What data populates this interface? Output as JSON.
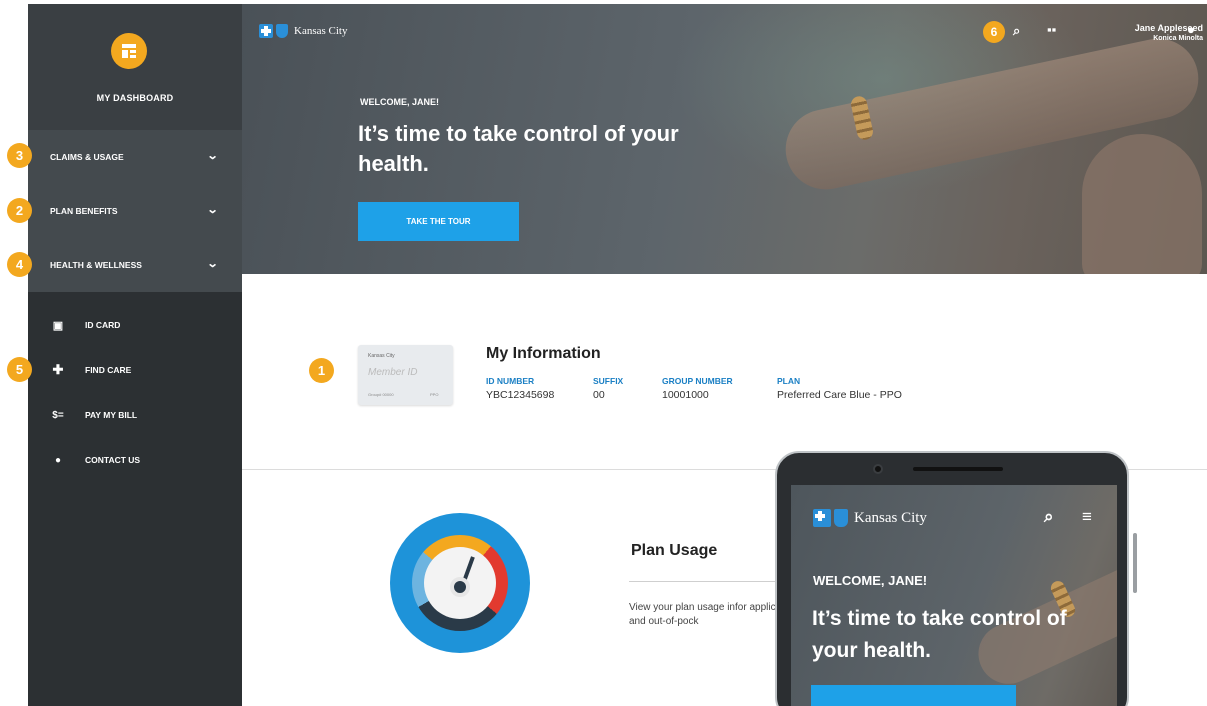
{
  "sidebar": {
    "dashboard_label": "MY DASHBOARD",
    "menu": [
      {
        "label": "CLAIMS & USAGE",
        "badge": "3"
      },
      {
        "label": "PLAN BENEFITS",
        "badge": "2"
      },
      {
        "label": "HEALTH & WELLNESS",
        "badge": "4"
      }
    ],
    "links": [
      {
        "label": "ID CARD",
        "icon": "id-card-icon",
        "glyph": "▣"
      },
      {
        "label": "FIND CARE",
        "icon": "plus-icon",
        "glyph": "✚",
        "badge": "5"
      },
      {
        "label": "PAY MY BILL",
        "icon": "dollar-icon",
        "glyph": "$="
      },
      {
        "label": "CONTACT US",
        "icon": "location-pin-icon",
        "glyph": "⬤"
      }
    ]
  },
  "header": {
    "brand": "Kansas City",
    "badge": "6",
    "user_name": "Jane Appleseed",
    "user_org": "Konica Minolta"
  },
  "hero": {
    "welcome": "WELCOME, JANE!",
    "headline": "It’s time to take control of your health.",
    "button": "TAKE THE TOUR"
  },
  "info": {
    "badge": "1",
    "title": "My Information",
    "card": {
      "brand": "Kansas City",
      "member": "Member ID",
      "group": "Group# 00000",
      "ppo": "PPO"
    },
    "columns": [
      {
        "label": "ID NUMBER",
        "value": "YBC12345698"
      },
      {
        "label": "SUFFIX",
        "value": "00"
      },
      {
        "label": "GROUP NUMBER",
        "value": "10001000"
      },
      {
        "label": "PLAN",
        "value": "Preferred Care Blue - PPO"
      }
    ]
  },
  "usage": {
    "title": "Plan Usage",
    "text": "View your plan usage infor applicable) and out-of-pock"
  },
  "mobile": {
    "brand": "Kansas City",
    "welcome": "WELCOME, JANE!",
    "headline": "It’s time to take control of your health."
  },
  "colors": {
    "accent": "#1ea1e8",
    "badge": "#f3a81f",
    "sidebar": "#2c3033",
    "label_blue": "#1a7fc4"
  }
}
